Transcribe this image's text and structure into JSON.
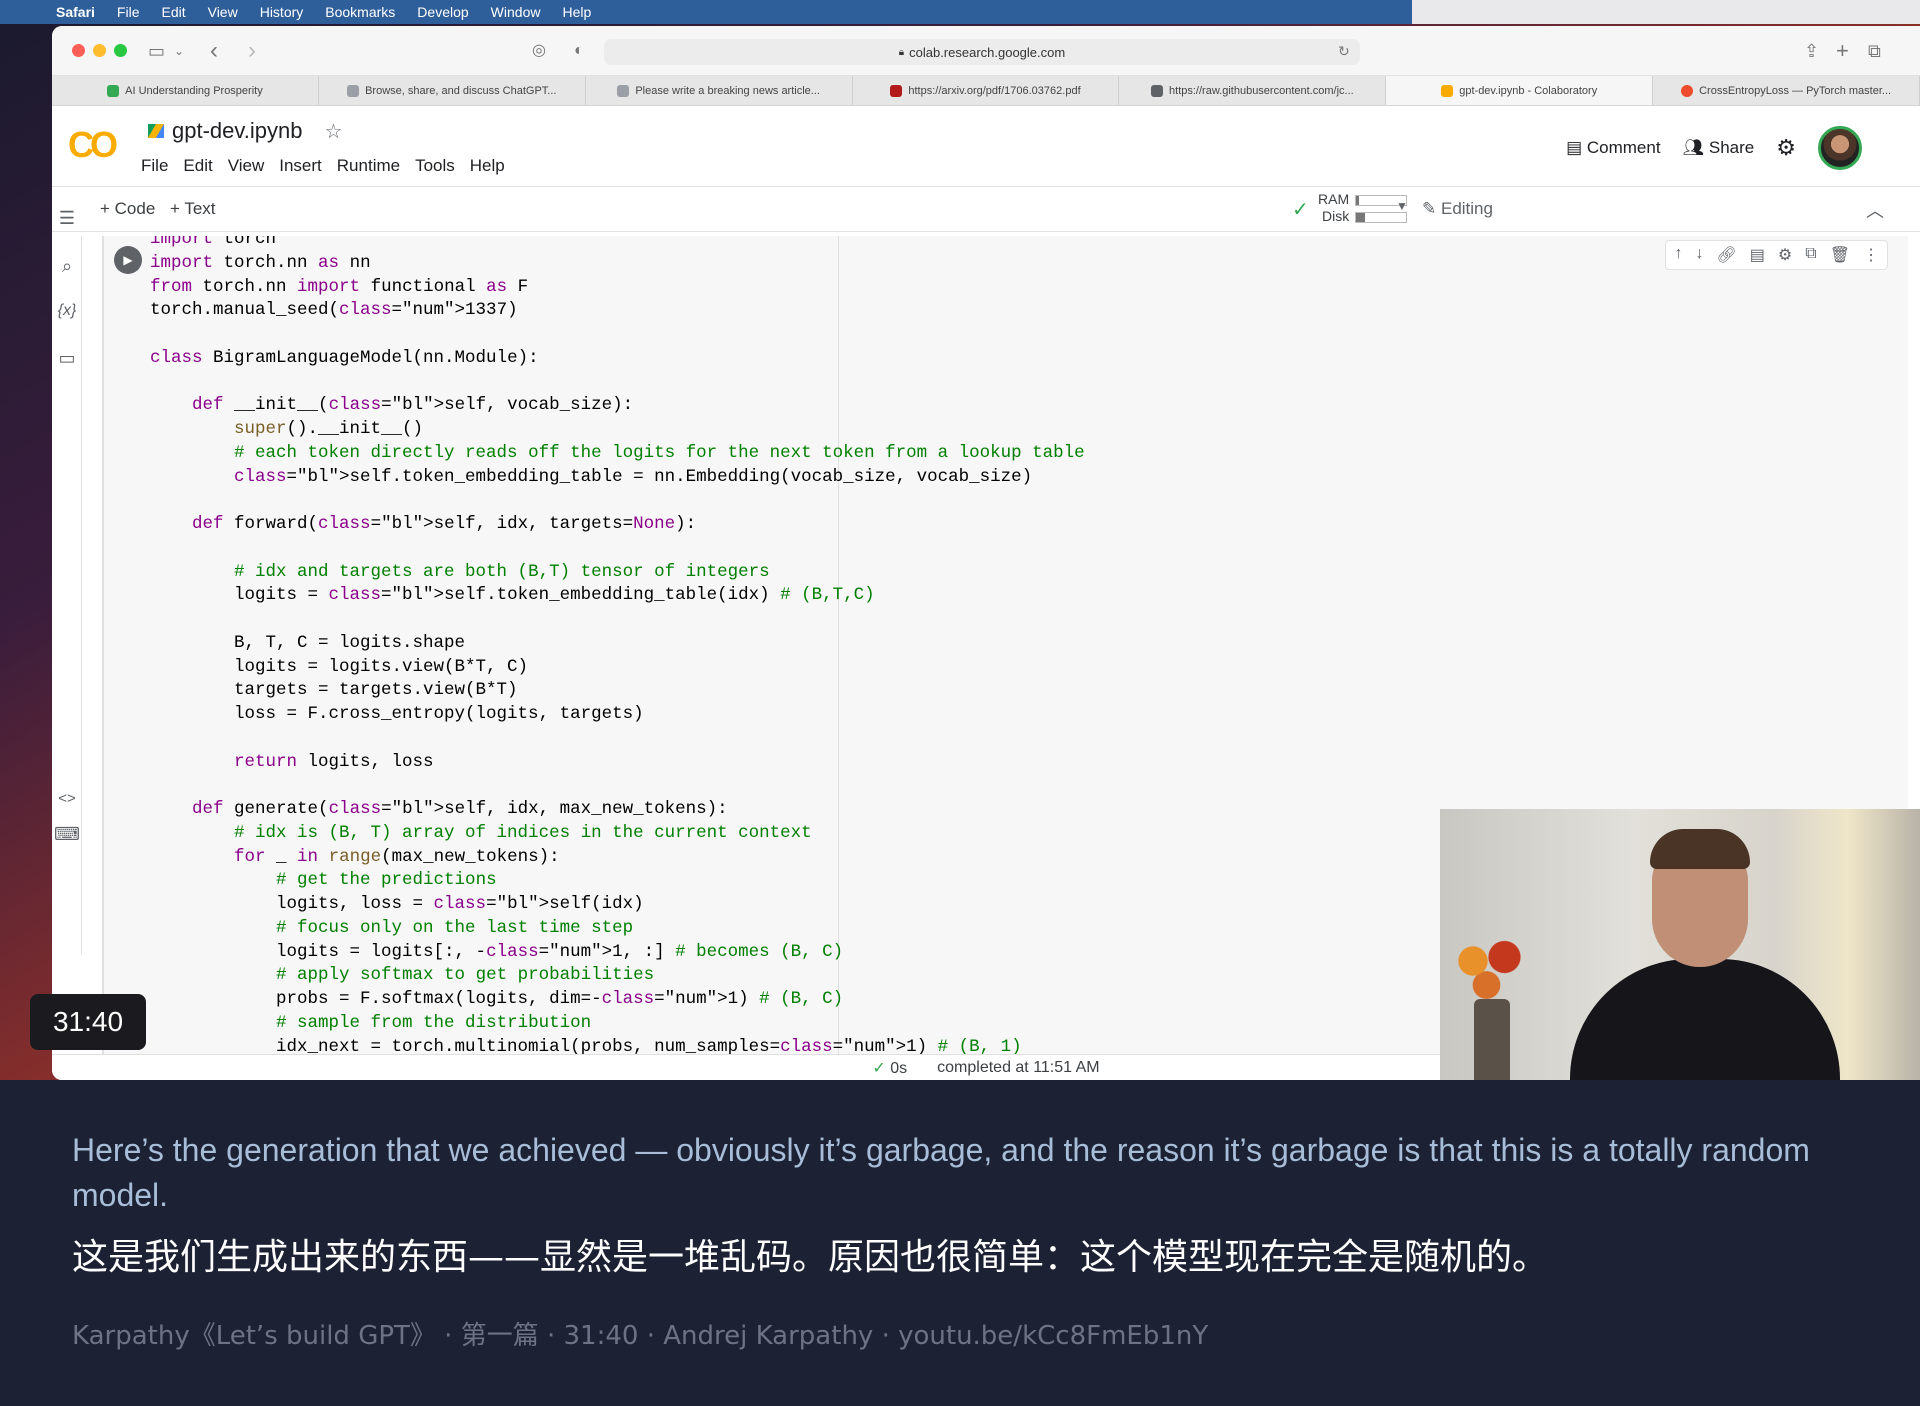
{
  "mac_menubar": {
    "app": "Safari",
    "items": [
      "File",
      "Edit",
      "View",
      "History",
      "Bookmarks",
      "Develop",
      "Window",
      "Help"
    ]
  },
  "browser": {
    "url": "colab.research.google.com",
    "tabs": [
      {
        "label": "AI Understanding Prosperity",
        "color": "#34a853"
      },
      {
        "label": "Browse, share, and discuss ChatGPT...",
        "color": "#9aa0a6"
      },
      {
        "label": "Please write a breaking news article...",
        "color": "#9aa0a6"
      },
      {
        "label": "https://arxiv.org/pdf/1706.03762.pdf",
        "color": "#b31b1b"
      },
      {
        "label": "https://raw.githubusercontent.com/jc...",
        "color": "#5f6368"
      },
      {
        "label": "gpt-dev.ipynb - Colaboratory",
        "color": "#f9ab00",
        "active": true
      },
      {
        "label": "CrossEntropyLoss — PyTorch master...",
        "color": "#ee4c2c"
      }
    ]
  },
  "colab": {
    "logo": "CO",
    "notebook_title": "gpt-dev.ipynb",
    "menu": [
      "File",
      "Edit",
      "View",
      "Insert",
      "Runtime",
      "Tools",
      "Help"
    ],
    "comment_label": "Comment",
    "share_label": "Share",
    "add_code": "+ Code",
    "add_text": "+ Text",
    "ram_label": "RAM",
    "disk_label": "Disk",
    "ram_fill": 0.05,
    "disk_fill": 0.18,
    "editing_label": "Editing"
  },
  "code_lines": [
    "import torch",
    "import torch.nn as nn",
    "from torch.nn import functional as F",
    "torch.manual_seed(1337)",
    "",
    "class BigramLanguageModel(nn.Module):",
    "",
    "    def __init__(self, vocab_size):",
    "        super().__init__()",
    "        # each token directly reads off the logits for the next token from a lookup table",
    "        self.token_embedding_table = nn.Embedding(vocab_size, vocab_size)",
    "",
    "    def forward(self, idx, targets=None):",
    "",
    "        # idx and targets are both (B,T) tensor of integers",
    "        logits = self.token_embedding_table(idx) # (B,T,C)",
    "",
    "        B, T, C = logits.shape",
    "        logits = logits.view(B*T, C)",
    "        targets = targets.view(B*T)",
    "        loss = F.cross_entropy(logits, targets)",
    "",
    "        return logits, loss",
    "",
    "    def generate(self, idx, max_new_tokens):",
    "        # idx is (B, T) array of indices in the current context",
    "        for _ in range(max_new_tokens):",
    "            # get the predictions",
    "            logits, loss = self(idx)",
    "            # focus only on the last time step",
    "            logits = logits[:, -1, :] # becomes (B, C)",
    "            # apply softmax to get probabilities",
    "            probs = F.softmax(logits, dim=-1) # (B, C)",
    "            # sample from the distribution",
    "            idx_next = torch.multinomial(probs, num_samples=1) # (B, 1)"
  ],
  "status": {
    "check": "✓",
    "duration": "0s",
    "message": "completed at 11:51 AM"
  },
  "video": {
    "timestamp": "31:40"
  },
  "subtitles": {
    "english": "Here’s the generation that we achieved — obviously it’s garbage, and the reason it’s garbage is that this is a totally random model.",
    "chinese": "这是我们生成出来的东西——显然是一堆乱码。原因也很简单：这个模型现在完全是随机的。",
    "meta": "Karpathy《Let’s build GPT》 · 第一篇 · 31:40 · Andrej Karpathy · youtu.be/kCc8FmEb1nY"
  }
}
